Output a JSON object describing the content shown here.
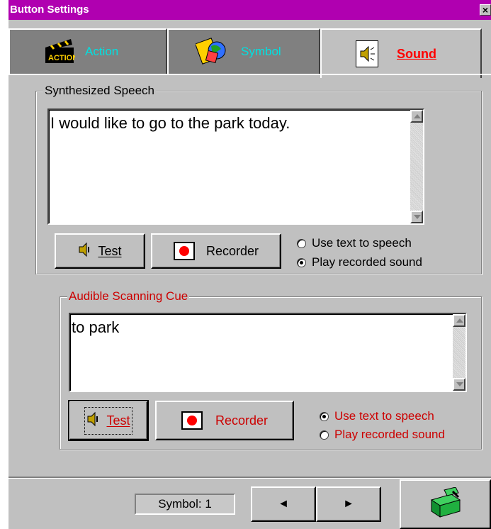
{
  "window": {
    "title": "Button Settings",
    "close_label": "×"
  },
  "tabs": [
    {
      "label": "Action",
      "icon": "clapperboard-icon"
    },
    {
      "label": "Symbol",
      "icon": "symbol-icon"
    },
    {
      "label": "Sound",
      "icon": "speaker-icon",
      "active": true
    }
  ],
  "synthesized": {
    "title": "Synthesized Speech",
    "text": "I would like to go to the park today.",
    "test_label": "Test",
    "recorder_label": "Recorder",
    "radio_tts": "Use text to speech",
    "radio_recorded": "Play recorded sound",
    "selected": "recorded"
  },
  "scanning": {
    "title": "Audible Scanning Cue",
    "text": "to park",
    "test_label": "Test",
    "recorder_label": "Recorder",
    "radio_tts": "Use text to speech",
    "radio_recorded": "Play recorded sound",
    "selected": "tts"
  },
  "footer": {
    "symbol_label": "Symbol: 1",
    "prev_arrow": "◄",
    "next_arrow": "►",
    "ok_icon": "green-box-icon"
  },
  "colors": {
    "titlebar": "#b000b0",
    "accent_red": "#cc0000",
    "tab_text": "#00e0e0"
  }
}
